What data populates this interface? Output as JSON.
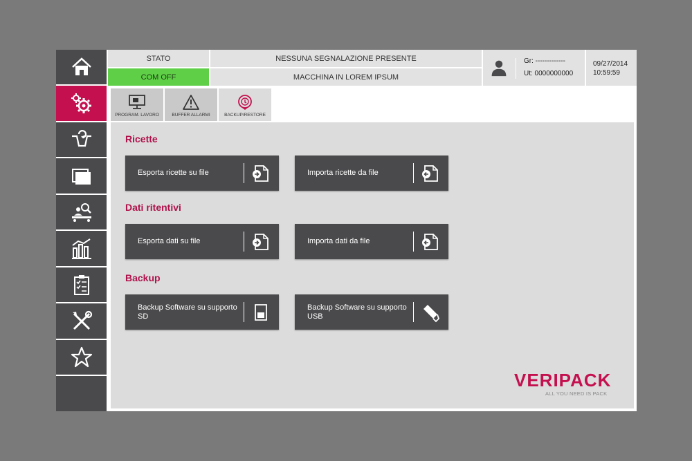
{
  "header": {
    "status_label": "STATO",
    "status_value": "COM OFF",
    "message_label": "NESSUNA SEGNALAZIONE PRESENTE",
    "machine_label": "MACCHINA IN LOREM IPSUM",
    "group": "Gr: -------------",
    "user": "Ut: 0000000000",
    "date": "09/27/2014",
    "time": "10:59:59"
  },
  "sidebar": {
    "items": [
      {
        "icon": "home-icon"
      },
      {
        "icon": "gears-icon",
        "active": true
      },
      {
        "icon": "recipe-flow-icon"
      },
      {
        "icon": "folder-icon"
      },
      {
        "icon": "inspection-icon"
      },
      {
        "icon": "statistics-icon"
      },
      {
        "icon": "checklist-icon"
      },
      {
        "icon": "tools-icon"
      },
      {
        "icon": "star-icon"
      }
    ]
  },
  "tabs": [
    {
      "label": "PROGRAM. LAVORO",
      "icon": "monitor-icon"
    },
    {
      "label": "BUFFER ALLARMI",
      "icon": "warning-icon"
    },
    {
      "label": "BACKUP/RESTORE",
      "icon": "backup-icon",
      "active": true
    }
  ],
  "sections": {
    "ricette": {
      "title": "Ricette",
      "export_label": "Esporta ricette su file",
      "import_label": "Importa ricette da file"
    },
    "dati": {
      "title": "Dati ritentivi",
      "export_label": "Esporta dati su file",
      "import_label": "Importa dati da file"
    },
    "backup": {
      "title": "Backup",
      "sd_label": "Backup Software su supporto SD",
      "usb_label": "Backup Software su supporto USB"
    }
  },
  "logo": {
    "brand": "VERIPACK",
    "tagline": "ALL YOU NEED IS PACK"
  },
  "colors": {
    "accent": "#c4104f",
    "status_ok": "#5fcf48",
    "sidebar": "#4a4a4d",
    "button": "#4a4a4c"
  }
}
